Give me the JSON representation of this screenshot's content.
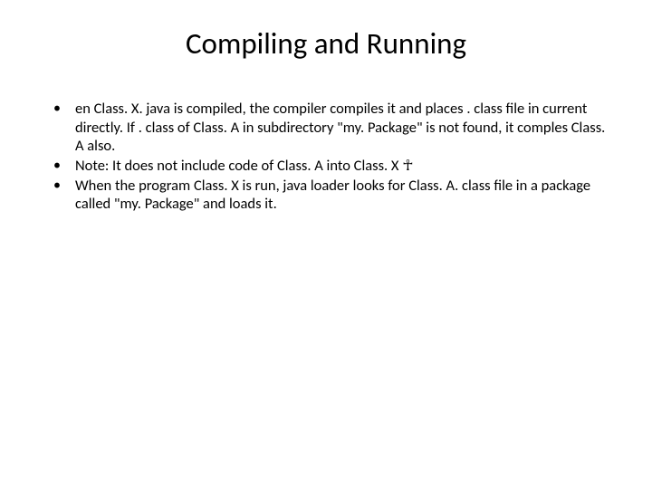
{
  "slide": {
    "title": "Compiling and Running",
    "bullets": [
      {
        "text": "en Class. X. java is compiled, the compiler compiles it and places . class file in current directly. If . class of Class. A in subdirectory \"my. Package\" is not found, it comples Class. A also."
      },
      {
        "text": "Note: It does not include code of Class. A into  Class. X ☥"
      },
      {
        "text": "When the program Class. X is run, java loader looks for Class. A. class file in a package called \"my. Package\" and loads it."
      }
    ]
  }
}
